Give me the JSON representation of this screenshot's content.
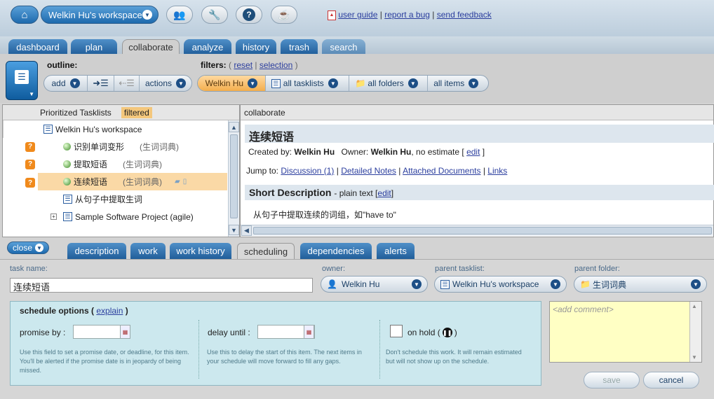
{
  "topbar": {
    "workspace": "Welkin Hu's workspace",
    "links": [
      "user guide",
      "report a bug",
      "send feedback"
    ],
    "separator": "|"
  },
  "tabs": [
    "dashboard",
    "plan",
    "collaborate",
    "analyze",
    "history",
    "trash",
    "search"
  ],
  "toolbar": {
    "outline_label": "outline:",
    "filters_label": "filters:",
    "filters_paren_open": "(",
    "filters_reset": "reset",
    "filters_separator": "|",
    "filters_selection": "selection",
    "filters_paren_close": ")",
    "outline_buttons": [
      "add",
      "actions"
    ],
    "filter_buttons": [
      "Welkin Hu",
      "all tasklists",
      "all folders",
      "all items"
    ]
  },
  "left_panel": {
    "header": "Prioritized Tasklists",
    "badge": "filtered",
    "workspace_row": "Welkin Hu's workspace",
    "items": [
      {
        "name": "识别单词变形",
        "folder": "(生词词典)"
      },
      {
        "name": "提取短语",
        "folder": "(生词词典)"
      },
      {
        "name": "连续短语",
        "folder": "(生词词典)"
      }
    ],
    "tasklist_row": "从句子中提取生词",
    "project_row": "Sample Software Project (agile)"
  },
  "right_panel": {
    "header": "collaborate",
    "title": "连续短语",
    "created_label": "Created by:",
    "created_by": "Welkin Hu",
    "owner_label": "Owner:",
    "owner": "Welkin Hu",
    "estimate": ", no estimate [",
    "edit": "edit",
    "bracket_close": "]",
    "jump_label": "Jump to:",
    "jump_links": [
      "Discussion (1)",
      "Detailed Notes",
      "Attached Documents",
      "Links"
    ],
    "separator": "|",
    "short_desc_title": "Short Description",
    "short_desc_sub": "- plain text [",
    "short_desc_text": "从句子中提取连续的词组，如\"have to\""
  },
  "bottom": {
    "close": "close",
    "tabs": [
      "description",
      "work",
      "work history",
      "scheduling",
      "dependencies",
      "alerts"
    ],
    "task_name_label": "task name:",
    "task_name": "连续短语",
    "owner_label": "owner:",
    "owner": "Welkin Hu",
    "parent_tasklist_label": "parent tasklist:",
    "parent_tasklist": "Welkin Hu's workspace",
    "parent_folder_label": "parent folder:",
    "parent_folder": "生词词典",
    "schedule_title": "schedule options (",
    "explain": "explain",
    "schedule_close": ")",
    "promise_label": "promise by :",
    "promise_help": "Use this field to set a promise date, or deadline, for this item. You'll be alerted if the promise date is in jeopardy of being missed.",
    "delay_label": "delay until :",
    "delay_help": "Use this to delay the start of this item. The next items in your schedule will move forward to fill any gaps.",
    "hold_label": "on hold (",
    "hold_close": ")",
    "hold_help": "Don't schedule this work. It will remain estimated but will not show up on the schedule.",
    "comment_placeholder": "<add comment>",
    "save": "save",
    "cancel": "cancel"
  }
}
